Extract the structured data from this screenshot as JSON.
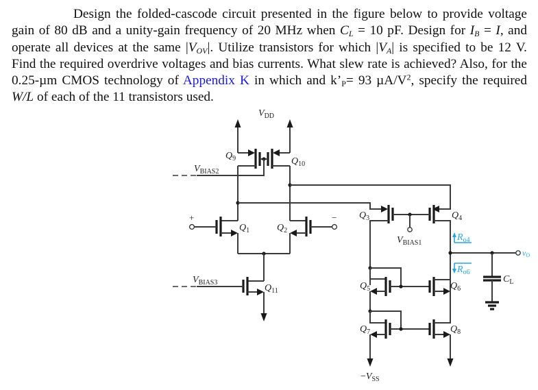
{
  "problem": {
    "seg1": "Design the folded-cascode circuit presented in the figure below to provide voltage gain of 80 dB and a unity-gain frequency of 20 MHz when ",
    "cl_sym": "C",
    "cl_sub": "L",
    "seg2": " = 10 pF. Design for ",
    "ib_sym": "I",
    "ib_sub": "B",
    "seg3": " = ",
    "i_sym": "I",
    "seg4": ", and operate all devices at the same |",
    "vov_sym": "V",
    "vov_sub": "OV",
    "seg5": "|. Utilize transistors for which |",
    "va_sym": "V",
    "va_sub": "A",
    "seg6": "| is specified to be 12 V. Find the required overdrive voltages and bias currents. What slew rate is achieved? Also, for the 0.25-µm CMOS technology of ",
    "appendix_link": "Appendix K",
    "seg7": " in which and k’",
    "kp_sub": "P",
    "seg8": "= 93 µA/V",
    "kp_sup": "2",
    "seg9": ", specify the required ",
    "wl": "W/L",
    "seg10": " of each of the 11 transistors used."
  },
  "circuit": {
    "vdd": {
      "sym": "V",
      "sub": "DD"
    },
    "vss": {
      "prefix": "−",
      "sym": "V",
      "sub": "SS"
    },
    "vbias1": {
      "sym": "V",
      "sub": "BIAS1"
    },
    "vbias2": {
      "sym": "V",
      "sub": "BIAS2"
    },
    "vbias3": {
      "sym": "V",
      "sub": "BIAS3"
    },
    "input_plus": "+",
    "input_minus": "−",
    "transistors": {
      "q1": {
        "sym": "Q",
        "sub": "1"
      },
      "q2": {
        "sym": "Q",
        "sub": "2"
      },
      "q3": {
        "sym": "Q",
        "sub": "3"
      },
      "q4": {
        "sym": "Q",
        "sub": "4"
      },
      "q5": {
        "sym": "Q",
        "sub": "5"
      },
      "q6": {
        "sym": "Q",
        "sub": "6"
      },
      "q7": {
        "sym": "Q",
        "sub": "7"
      },
      "q8": {
        "sym": "Q",
        "sub": "8"
      },
      "q9": {
        "sym": "Q",
        "sub": "9"
      },
      "q10": {
        "sym": "Q",
        "sub": "10"
      },
      "q11": {
        "sym": "Q",
        "sub": "11"
      }
    },
    "ro4": {
      "sym": "R",
      "sub": "o4"
    },
    "ro6": {
      "sym": "R",
      "sub": "o6"
    },
    "cl": {
      "sym": "C",
      "sub": "L"
    },
    "vo": {
      "sym": "v",
      "sub": "O"
    },
    "annotation_color": "#27a4e0"
  }
}
